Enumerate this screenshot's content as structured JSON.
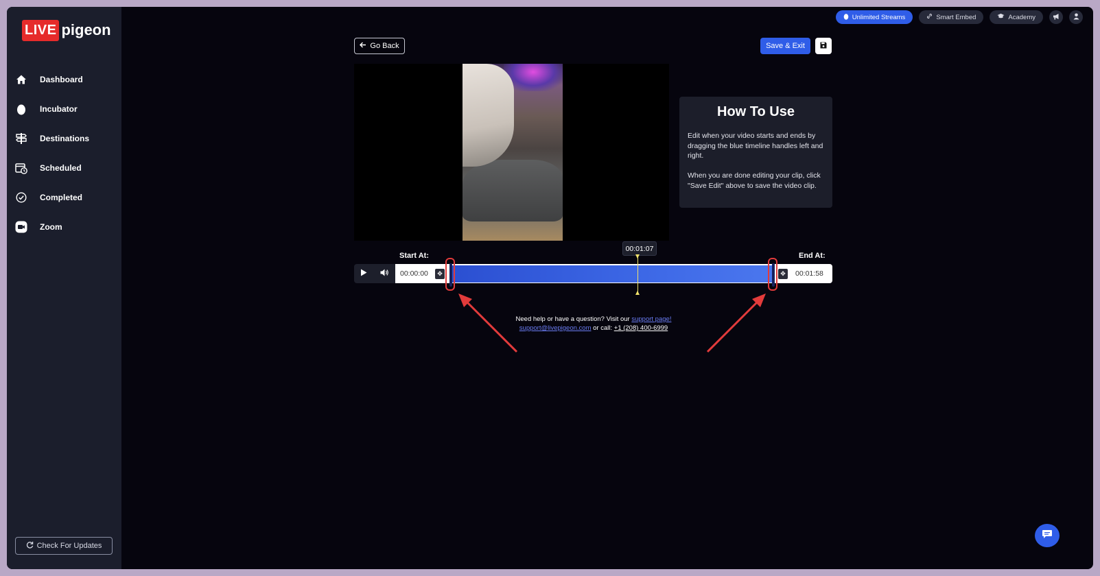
{
  "app": {
    "logo_live": "LIVE",
    "logo_pigeon": "pigeon"
  },
  "sidebar": {
    "items": [
      {
        "label": "Dashboard",
        "icon": "home-icon"
      },
      {
        "label": "Incubator",
        "icon": "egg-icon"
      },
      {
        "label": "Destinations",
        "icon": "signpost-icon"
      },
      {
        "label": "Scheduled",
        "icon": "calendar-clock-icon"
      },
      {
        "label": "Completed",
        "icon": "check-circle-icon"
      },
      {
        "label": "Zoom",
        "icon": "video-camera-icon"
      }
    ],
    "update_button": "Check For Updates"
  },
  "topbar": {
    "unlimited_streams": "Unlimited Streams",
    "smart_embed": "Smart Embed",
    "academy": "Academy"
  },
  "toolbar": {
    "go_back": "Go Back",
    "save_exit": "Save & Exit"
  },
  "howto": {
    "title": "How To Use",
    "p1": "Edit when your video starts and ends by dragging the blue timeline handles left and right.",
    "p2": "When you are done editing your clip, click \"Save Edit\" above to save the video clip."
  },
  "editor": {
    "start_label": "Start At:",
    "end_label": "End At:",
    "start_time": "00:00:00",
    "end_time": "00:01:58",
    "playhead_time": "00:01:07"
  },
  "help": {
    "text1": "Need help or have a question? Visit our ",
    "support_link": "support page!",
    "email": "support@livepigeon.com",
    "text2": " or call: ",
    "phone": "+1 (208) 400-6999"
  },
  "colors": {
    "accent": "#2f5de8",
    "sidebar_bg": "#1b1e2c",
    "annotation": "#e23b3b",
    "playhead": "#f2e36b"
  }
}
